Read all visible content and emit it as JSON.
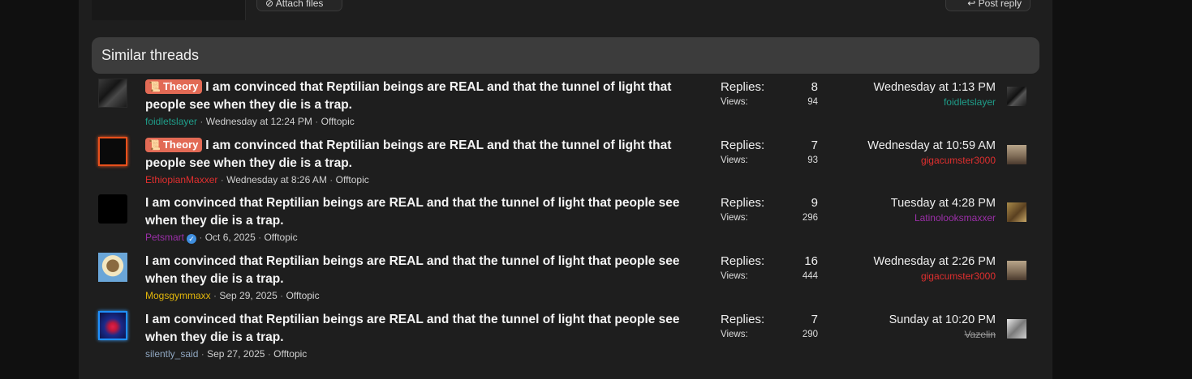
{
  "top_actions": {
    "attach_label": "Attach files",
    "reply_label": "Post reply"
  },
  "section": {
    "title": "Similar threads"
  },
  "colors": {
    "header_bg": "#3c3c3c",
    "prefix_bg": "#e26a55",
    "teal_user": "#1f9e8a",
    "red_user": "#e02f2f",
    "purple_user": "#9b2fa8",
    "gold_user": "#e3b70b",
    "steel_user": "#8fa6c0",
    "gray_user": "#9a9a9a"
  },
  "threads": [
    {
      "prefix": "Theory",
      "title": "I am convinced that Reptilian beings are REAL and that the tunnel of light that people see when they die is a trap.",
      "author": "foidletslayer",
      "started": "Wednesday at 12:24 PM",
      "forum": "Offtopic",
      "replies_label": "Replies:",
      "replies": "8",
      "views_label": "Views:",
      "views": "94",
      "last_post_date": "Wednesday at 1:13 PM",
      "last_poster": "foidletslayer"
    },
    {
      "prefix": "Theory",
      "title": "I am convinced that Reptilian beings are REAL and that the tunnel of light that people see when they die is a trap.",
      "author": "EthiopianMaxxer",
      "started": "Wednesday at 8:26 AM",
      "forum": "Offtopic",
      "replies_label": "Replies:",
      "replies": "7",
      "views_label": "Views:",
      "views": "93",
      "last_post_date": "Wednesday at 10:59 AM",
      "last_poster": "gigacumster3000"
    },
    {
      "prefix": "",
      "title": "I am convinced that Reptilian beings are REAL and that the tunnel of light that people see when they die is a trap.",
      "author": "Petsmart",
      "started": "Oct 6, 2025",
      "forum": "Offtopic",
      "replies_label": "Replies:",
      "replies": "9",
      "views_label": "Views:",
      "views": "296",
      "last_post_date": "Tuesday at 4:28 PM",
      "last_poster": "Latinolooksmaxxer"
    },
    {
      "prefix": "",
      "title": "I am convinced that Reptilian beings are REAL and that the tunnel of light that people see when they die is a trap.",
      "author": "Mogsgymmaxx",
      "started": "Sep 29, 2025",
      "forum": "Offtopic",
      "replies_label": "Replies:",
      "replies": "16",
      "views_label": "Views:",
      "views": "444",
      "last_post_date": "Wednesday at 2:26 PM",
      "last_poster": "gigacumster3000"
    },
    {
      "prefix": "",
      "title": "I am convinced that Reptilian beings are REAL and that the tunnel of light that people see when they die is a trap.",
      "author": "silently_said",
      "started": "Sep 27, 2025",
      "forum": "Offtopic",
      "replies_label": "Replies:",
      "replies": "7",
      "views_label": "Views:",
      "views": "290",
      "last_post_date": "Sunday at 10:20 PM",
      "last_poster": "Vazelin"
    }
  ]
}
